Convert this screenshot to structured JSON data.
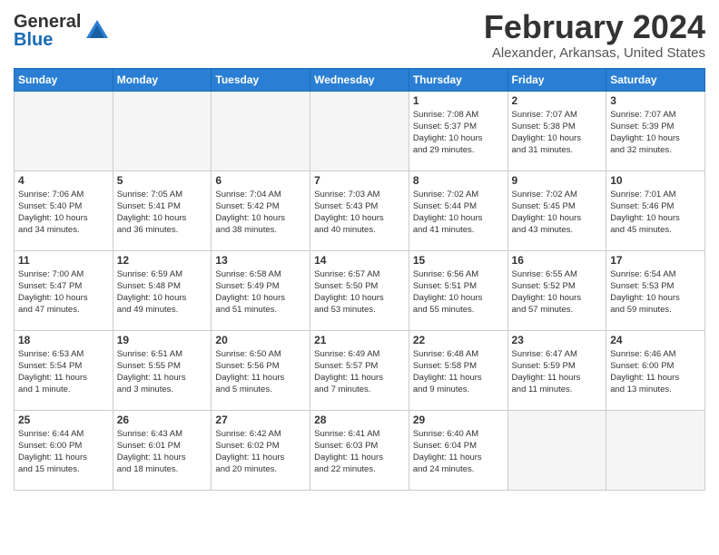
{
  "header": {
    "logo_general": "General",
    "logo_blue": "Blue",
    "title": "February 2024",
    "location": "Alexander, Arkansas, United States"
  },
  "days_of_week": [
    "Sunday",
    "Monday",
    "Tuesday",
    "Wednesday",
    "Thursday",
    "Friday",
    "Saturday"
  ],
  "weeks": [
    [
      {
        "day": "",
        "info": ""
      },
      {
        "day": "",
        "info": ""
      },
      {
        "day": "",
        "info": ""
      },
      {
        "day": "",
        "info": ""
      },
      {
        "day": "1",
        "info": "Sunrise: 7:08 AM\nSunset: 5:37 PM\nDaylight: 10 hours\nand 29 minutes."
      },
      {
        "day": "2",
        "info": "Sunrise: 7:07 AM\nSunset: 5:38 PM\nDaylight: 10 hours\nand 31 minutes."
      },
      {
        "day": "3",
        "info": "Sunrise: 7:07 AM\nSunset: 5:39 PM\nDaylight: 10 hours\nand 32 minutes."
      }
    ],
    [
      {
        "day": "4",
        "info": "Sunrise: 7:06 AM\nSunset: 5:40 PM\nDaylight: 10 hours\nand 34 minutes."
      },
      {
        "day": "5",
        "info": "Sunrise: 7:05 AM\nSunset: 5:41 PM\nDaylight: 10 hours\nand 36 minutes."
      },
      {
        "day": "6",
        "info": "Sunrise: 7:04 AM\nSunset: 5:42 PM\nDaylight: 10 hours\nand 38 minutes."
      },
      {
        "day": "7",
        "info": "Sunrise: 7:03 AM\nSunset: 5:43 PM\nDaylight: 10 hours\nand 40 minutes."
      },
      {
        "day": "8",
        "info": "Sunrise: 7:02 AM\nSunset: 5:44 PM\nDaylight: 10 hours\nand 41 minutes."
      },
      {
        "day": "9",
        "info": "Sunrise: 7:02 AM\nSunset: 5:45 PM\nDaylight: 10 hours\nand 43 minutes."
      },
      {
        "day": "10",
        "info": "Sunrise: 7:01 AM\nSunset: 5:46 PM\nDaylight: 10 hours\nand 45 minutes."
      }
    ],
    [
      {
        "day": "11",
        "info": "Sunrise: 7:00 AM\nSunset: 5:47 PM\nDaylight: 10 hours\nand 47 minutes."
      },
      {
        "day": "12",
        "info": "Sunrise: 6:59 AM\nSunset: 5:48 PM\nDaylight: 10 hours\nand 49 minutes."
      },
      {
        "day": "13",
        "info": "Sunrise: 6:58 AM\nSunset: 5:49 PM\nDaylight: 10 hours\nand 51 minutes."
      },
      {
        "day": "14",
        "info": "Sunrise: 6:57 AM\nSunset: 5:50 PM\nDaylight: 10 hours\nand 53 minutes."
      },
      {
        "day": "15",
        "info": "Sunrise: 6:56 AM\nSunset: 5:51 PM\nDaylight: 10 hours\nand 55 minutes."
      },
      {
        "day": "16",
        "info": "Sunrise: 6:55 AM\nSunset: 5:52 PM\nDaylight: 10 hours\nand 57 minutes."
      },
      {
        "day": "17",
        "info": "Sunrise: 6:54 AM\nSunset: 5:53 PM\nDaylight: 10 hours\nand 59 minutes."
      }
    ],
    [
      {
        "day": "18",
        "info": "Sunrise: 6:53 AM\nSunset: 5:54 PM\nDaylight: 11 hours\nand 1 minute."
      },
      {
        "day": "19",
        "info": "Sunrise: 6:51 AM\nSunset: 5:55 PM\nDaylight: 11 hours\nand 3 minutes."
      },
      {
        "day": "20",
        "info": "Sunrise: 6:50 AM\nSunset: 5:56 PM\nDaylight: 11 hours\nand 5 minutes."
      },
      {
        "day": "21",
        "info": "Sunrise: 6:49 AM\nSunset: 5:57 PM\nDaylight: 11 hours\nand 7 minutes."
      },
      {
        "day": "22",
        "info": "Sunrise: 6:48 AM\nSunset: 5:58 PM\nDaylight: 11 hours\nand 9 minutes."
      },
      {
        "day": "23",
        "info": "Sunrise: 6:47 AM\nSunset: 5:59 PM\nDaylight: 11 hours\nand 11 minutes."
      },
      {
        "day": "24",
        "info": "Sunrise: 6:46 AM\nSunset: 6:00 PM\nDaylight: 11 hours\nand 13 minutes."
      }
    ],
    [
      {
        "day": "25",
        "info": "Sunrise: 6:44 AM\nSunset: 6:00 PM\nDaylight: 11 hours\nand 15 minutes."
      },
      {
        "day": "26",
        "info": "Sunrise: 6:43 AM\nSunset: 6:01 PM\nDaylight: 11 hours\nand 18 minutes."
      },
      {
        "day": "27",
        "info": "Sunrise: 6:42 AM\nSunset: 6:02 PM\nDaylight: 11 hours\nand 20 minutes."
      },
      {
        "day": "28",
        "info": "Sunrise: 6:41 AM\nSunset: 6:03 PM\nDaylight: 11 hours\nand 22 minutes."
      },
      {
        "day": "29",
        "info": "Sunrise: 6:40 AM\nSunset: 6:04 PM\nDaylight: 11 hours\nand 24 minutes."
      },
      {
        "day": "",
        "info": ""
      },
      {
        "day": "",
        "info": ""
      }
    ]
  ]
}
